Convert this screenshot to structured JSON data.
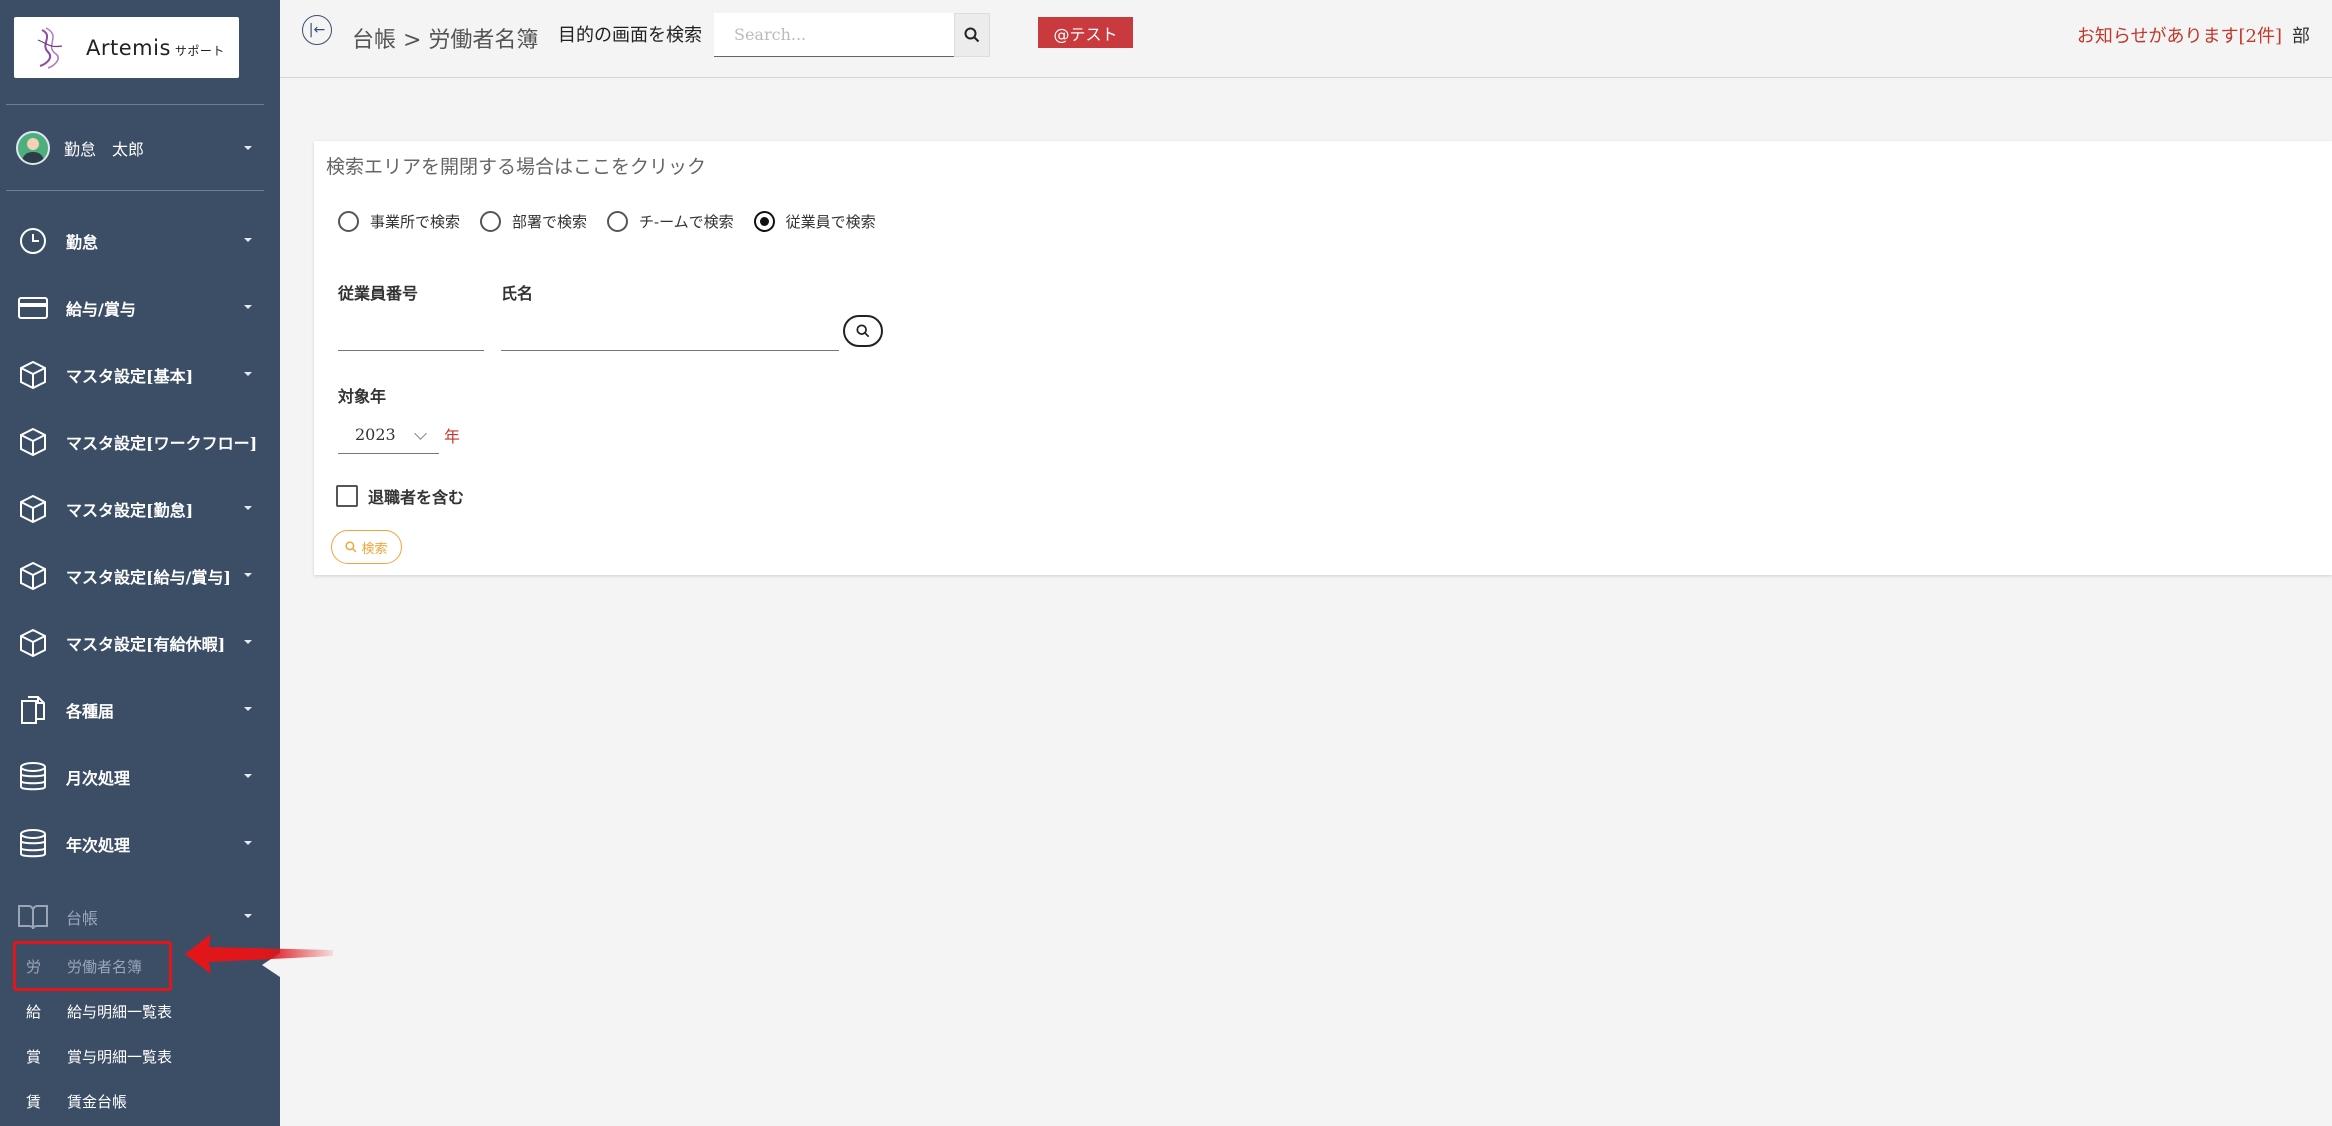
{
  "app": {
    "logo_text": "Artemis",
    "logo_sub": "サポート"
  },
  "user": {
    "name": "勤怠　太郎"
  },
  "sidebar": {
    "items": [
      {
        "label": "勤怠",
        "icon": "clock-icon"
      },
      {
        "label": "給与/賞与",
        "icon": "credit-card-icon"
      },
      {
        "label": "マスタ設定[基本]",
        "icon": "cube-icon"
      },
      {
        "label": "マスタ設定[ワークフロー]",
        "icon": "cube-icon"
      },
      {
        "label": "マスタ設定[勤怠]",
        "icon": "cube-icon"
      },
      {
        "label": "マスタ設定[給与/賞与]",
        "icon": "cube-icon"
      },
      {
        "label": "マスタ設定[有給休暇]",
        "icon": "cube-icon"
      },
      {
        "label": "各種届",
        "icon": "copy-icon"
      },
      {
        "label": "月次処理",
        "icon": "database-icon"
      },
      {
        "label": "年次処理",
        "icon": "database-icon"
      },
      {
        "label": "台帳",
        "icon": "book-icon"
      }
    ],
    "sub_items": [
      {
        "abbr": "労",
        "label": "労働者名簿",
        "active": true
      },
      {
        "abbr": "給",
        "label": "給与明細一覧表"
      },
      {
        "abbr": "賞",
        "label": "賞与明細一覧表"
      },
      {
        "abbr": "賃",
        "label": "賃金台帳"
      }
    ]
  },
  "header": {
    "back_icon": "|←",
    "breadcrumb": "台帳 > 労働者名簿",
    "search_label": "目的の画面を検索",
    "search_placeholder": "Search...",
    "test_badge": "@テスト",
    "notice": "お知らせがあります[2件]",
    "notice_cut": "部"
  },
  "search_panel": {
    "title": "検索エリアを開閉する場合はここをクリック",
    "radio_options": [
      {
        "label": "事業所で検索",
        "selected": false
      },
      {
        "label": "部署で検索",
        "selected": false
      },
      {
        "label": "チ-ームで検索",
        "selected": false
      },
      {
        "label": "従業員で検索",
        "selected": true
      }
    ],
    "employee_number_label": "従業員番号",
    "employee_number_value": "",
    "name_label": "氏名",
    "name_value": "",
    "target_year_label": "対象年",
    "target_year_value": "2023",
    "year_unit": "年",
    "include_retired_label": "退職者を含む",
    "include_retired_checked": false,
    "search_button": "検索"
  },
  "colors": {
    "sidebar_bg": "#3b4e66",
    "badge_red": "#c83a3d",
    "notice_red": "#c0392b",
    "search_orange": "#f2a43a",
    "highlight_red": "#e0161b"
  }
}
